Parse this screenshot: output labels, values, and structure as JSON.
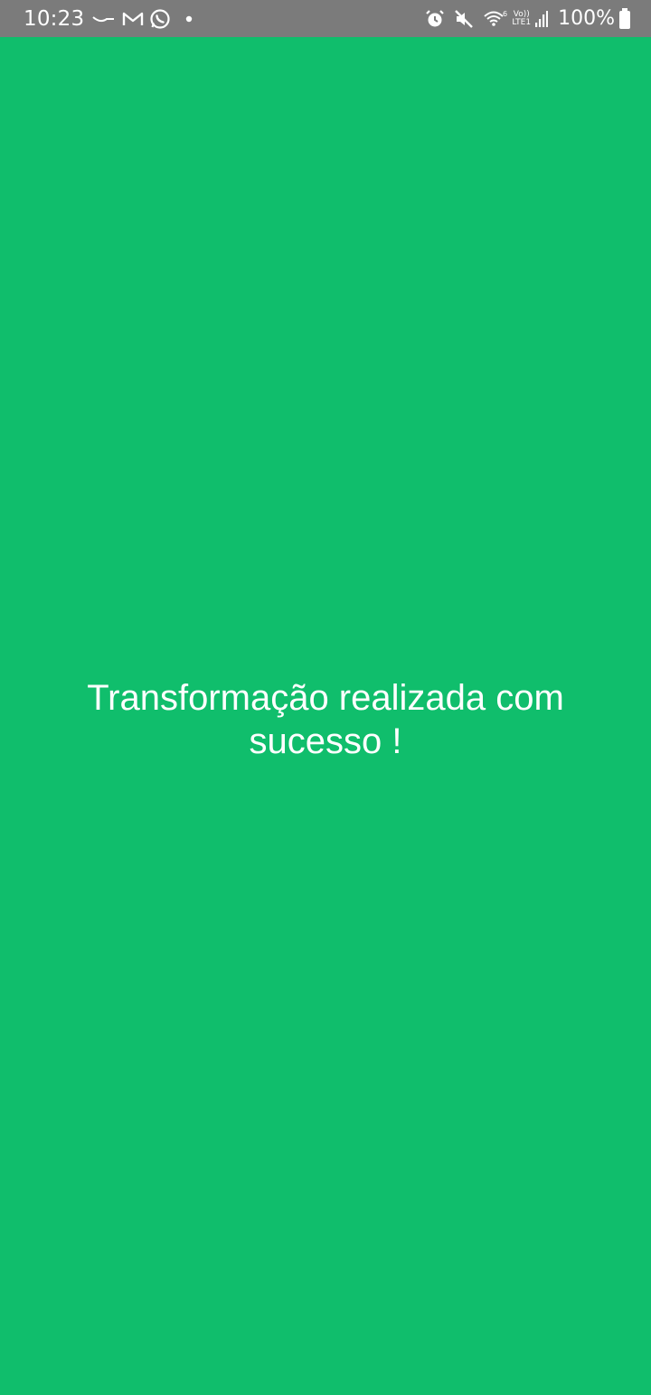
{
  "status_bar": {
    "time": "10:23",
    "battery_percent": "100%",
    "network_label_top": "Vo))",
    "network_label_bottom": "LTE1",
    "left_icons": [
      "lightning-rod-icon",
      "gmail-icon",
      "whatsapp-icon",
      "notification-dot-icon"
    ],
    "right_icons": [
      "alarm-icon",
      "mute-icon",
      "wifi-icon",
      "signal-icon",
      "battery-icon"
    ]
  },
  "colors": {
    "background": "#10be6c",
    "status_bar": "#7b7b7b",
    "text": "#ffffff"
  },
  "main": {
    "message": "Transformação realizada com sucesso !"
  }
}
